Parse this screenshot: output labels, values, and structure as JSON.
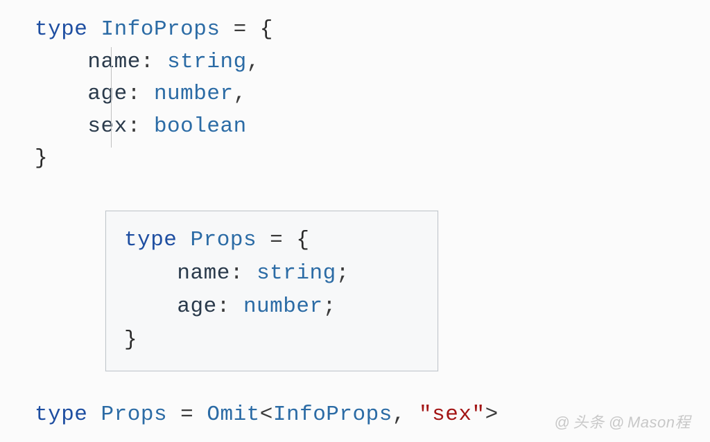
{
  "main": {
    "l1": {
      "kw": "type",
      "name": "InfoProps",
      "eq": " = ",
      "brace": "{"
    },
    "l2": {
      "indent": "    ",
      "prop": "name",
      "colon": ": ",
      "ptype": "string",
      "comma": ","
    },
    "l3": {
      "indent": "    ",
      "prop": "age",
      "colon": ": ",
      "ptype": "number",
      "comma": ","
    },
    "l4": {
      "indent": "    ",
      "prop": "sex",
      "colon": ": ",
      "ptype": "boolean"
    },
    "l5": {
      "brace": "}"
    }
  },
  "tooltip": {
    "l1": {
      "kw": "type",
      "name": "Props",
      "eq": " = ",
      "brace": "{"
    },
    "l2": {
      "indent": "    ",
      "prop": "name",
      "colon": ": ",
      "ptype": "string",
      "semi": ";"
    },
    "l3": {
      "indent": "    ",
      "prop": "age",
      "colon": ": ",
      "ptype": "number",
      "semi": ";"
    },
    "l4": {
      "brace": "}"
    }
  },
  "bottom": {
    "kw": "type",
    "name": "Props",
    "eq": " = ",
    "util": "Omit",
    "lt": "<",
    "ref": "InfoProps",
    "comma": ", ",
    "str": "\"sex\"",
    "gt": ">"
  },
  "watermark": {
    "prefix1": "@",
    "text1": "头条",
    "prefix2": "@",
    "text2": "Mason程"
  }
}
